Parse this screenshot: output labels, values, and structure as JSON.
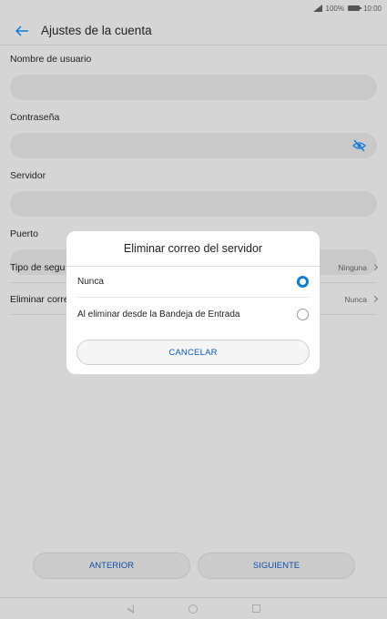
{
  "status_bar": {
    "battery": "100%",
    "time": "10:00"
  },
  "app_bar": {
    "title": "Ajustes de la cuenta"
  },
  "form": {
    "username_label": "Nombre de usuario",
    "password_label": "Contraseña",
    "server_label": "Servidor",
    "port_label": "Puerto"
  },
  "settings": {
    "security_label": "Tipo de seguridad",
    "security_label_visible": "Tipo de segu",
    "security_value": "Ninguna",
    "delete_label_visible": "Eliminar corre",
    "delete_value": "Nunca"
  },
  "dialog": {
    "title": "Eliminar correo del servidor",
    "options": [
      {
        "label": "Nunca",
        "selected": true
      },
      {
        "label": "Al eliminar desde la Bandeja de Entrada",
        "selected": false
      }
    ],
    "cancel_label": "CANCELAR"
  },
  "buttons": {
    "previous_label": "ANTERIOR",
    "next_label": "SIGUIENTE"
  },
  "colors": {
    "accent": "#0a7dde",
    "background_dimmed": "#d5d5d5"
  }
}
